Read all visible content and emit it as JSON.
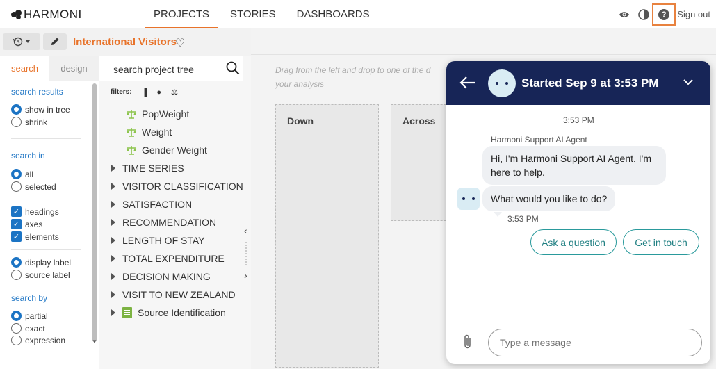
{
  "app": {
    "name": "HARMONI"
  },
  "nav": {
    "tabs": [
      "PROJECTS",
      "STORIES",
      "DASHBOARDS"
    ],
    "active": "PROJECTS"
  },
  "header_right": {
    "sign_out": "Sign out",
    "icons": [
      "eye-icon",
      "contrast-icon",
      "help-icon"
    ]
  },
  "project": {
    "title": "International Visitors"
  },
  "left_panel": {
    "tabs": [
      "search",
      "design"
    ],
    "active_tab": "search",
    "search_results": {
      "label": "search results",
      "options": [
        "show in tree",
        "shrink"
      ],
      "selected": "show in tree"
    },
    "search_in": {
      "label": "search in",
      "options": [
        "all",
        "selected"
      ],
      "selected": "all"
    },
    "include": {
      "options": [
        "headings",
        "axes",
        "elements"
      ],
      "checked": [
        "headings",
        "axes",
        "elements"
      ]
    },
    "label_type": {
      "options": [
        "display label",
        "source label"
      ],
      "selected": "display label"
    },
    "search_by": {
      "label": "search by",
      "options": [
        "partial",
        "exact",
        "expression"
      ],
      "selected": "partial"
    }
  },
  "tree": {
    "search_placeholder": "search project tree",
    "filters_label": "filters:",
    "weights": [
      "PopWeight",
      "Weight",
      "Gender Weight"
    ],
    "folders": [
      "TIME SERIES",
      "VISITOR CLASSIFICATION",
      "SATISFACTION",
      "RECOMMENDATION",
      "LENGTH OF STAY",
      "TOTAL EXPENDITURE",
      "DECISION MAKING",
      "VISIT TO NEW ZEALAND"
    ],
    "source": "Source Identification"
  },
  "main": {
    "hint_line1": "Drag from the left and drop to one of the d",
    "hint_line2": "your analysis",
    "zones": [
      "Down",
      "Across"
    ]
  },
  "chat": {
    "title": "Started Sep 9 at 3:53 PM",
    "top_time": "3:53 PM",
    "agent_name": "Harmoni Support AI Agent",
    "msg1": "Hi, I'm Harmoni Support AI Agent. I'm here to help.",
    "msg2": "What would you like to do?",
    "msg_time": "3:53 PM",
    "quick_replies": [
      "Ask a question",
      "Get in touch"
    ],
    "input_placeholder": "Type a message"
  }
}
